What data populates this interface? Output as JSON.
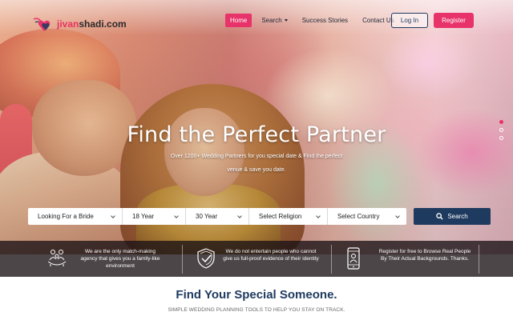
{
  "brand": {
    "name_part1": "jivan",
    "name_part2": "shadi.com"
  },
  "nav": {
    "items": [
      {
        "label": "Home",
        "active": true
      },
      {
        "label": "Search",
        "dropdown": true
      },
      {
        "label": "Success Stories"
      },
      {
        "label": "Contact Us"
      }
    ],
    "login_label": "Log In",
    "register_label": "Register"
  },
  "hero": {
    "title": "Find the Perfect Partner",
    "subtitle": "Over 1200+ Wedding Partners for you special date & Find the perfect venue & save you date.",
    "slides": 3,
    "active_slide": 1
  },
  "search": {
    "looking_for": "Looking For a Bride",
    "age_from": "18 Year",
    "age_to": "30 Year",
    "religion": "Select Religion",
    "country": "Select Country",
    "button_label": "Search"
  },
  "features": [
    {
      "icon": "family-icon",
      "text": "We are the only match-making agency that gives you a family-like environment"
    },
    {
      "icon": "shield-check-icon",
      "text": "We do not entertain people who cannot give us full-proof evidence of their identity"
    },
    {
      "icon": "mobile-profile-icon",
      "text": "Register for free to Browse Real People By Their Actual Backgrounds. Thanks."
    }
  ],
  "section": {
    "title": "Find Your Special Someone.",
    "subtitle": "SIMPLE WEDDING PLANNING TOOLS TO HELP YOU STAY ON TRACK."
  },
  "colors": {
    "accent": "#e8336a",
    "navy": "#1e3a5f"
  }
}
